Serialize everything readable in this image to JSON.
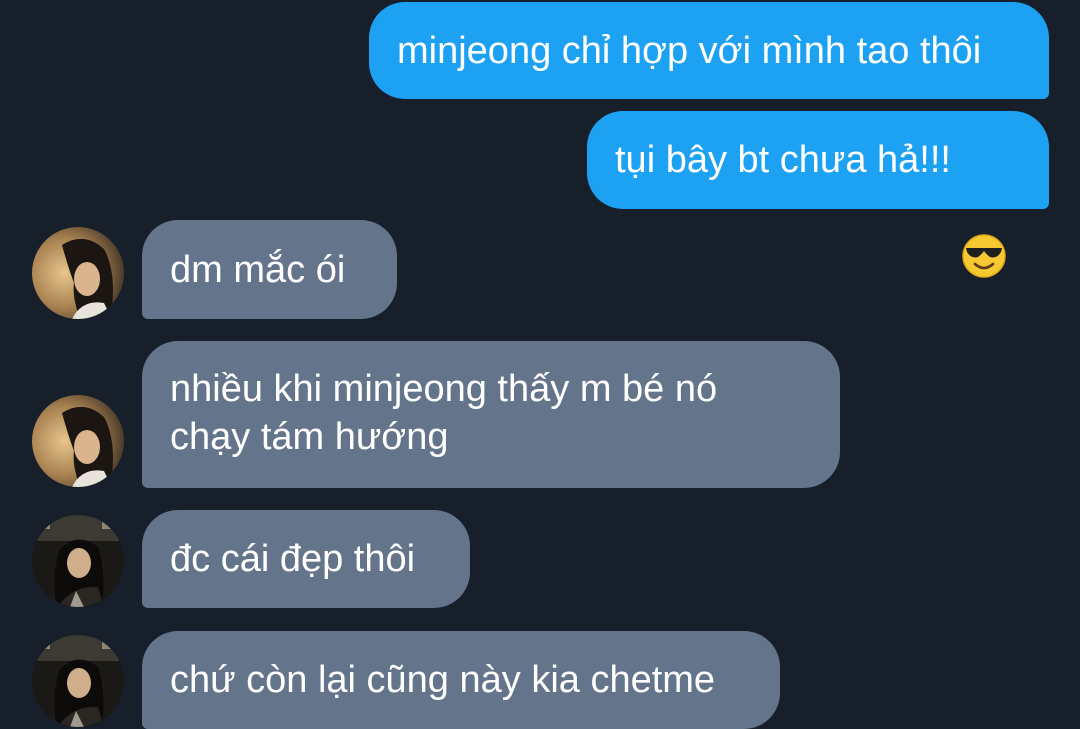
{
  "messages": [
    {
      "side": "out",
      "text": "minjeong chỉ hợp với mình tao thôi"
    },
    {
      "side": "out",
      "text": "tụi bây bt chưa hả!!!",
      "emoji": "smiling-face-with-sunglasses-icon"
    },
    {
      "side": "in",
      "text": "dm mắc ói",
      "avatar": "avatar-warm-portrait"
    },
    {
      "side": "in",
      "text": "nhiều khi minjeong thấy m bé nó\nchạy tám hướng",
      "avatar": "avatar-warm-portrait"
    },
    {
      "side": "in",
      "text": "đc cái đẹp thôi",
      "avatar": "avatar-dark-portrait"
    },
    {
      "side": "in",
      "text": "chứ còn lại cũng này kia chetme",
      "avatar": "avatar-dark-portrait"
    }
  ],
  "colors": {
    "background": "#161f2a",
    "outgoing_bubble": "#1da1f2",
    "incoming_bubble": "#64748a",
    "text": "#ffffff"
  }
}
